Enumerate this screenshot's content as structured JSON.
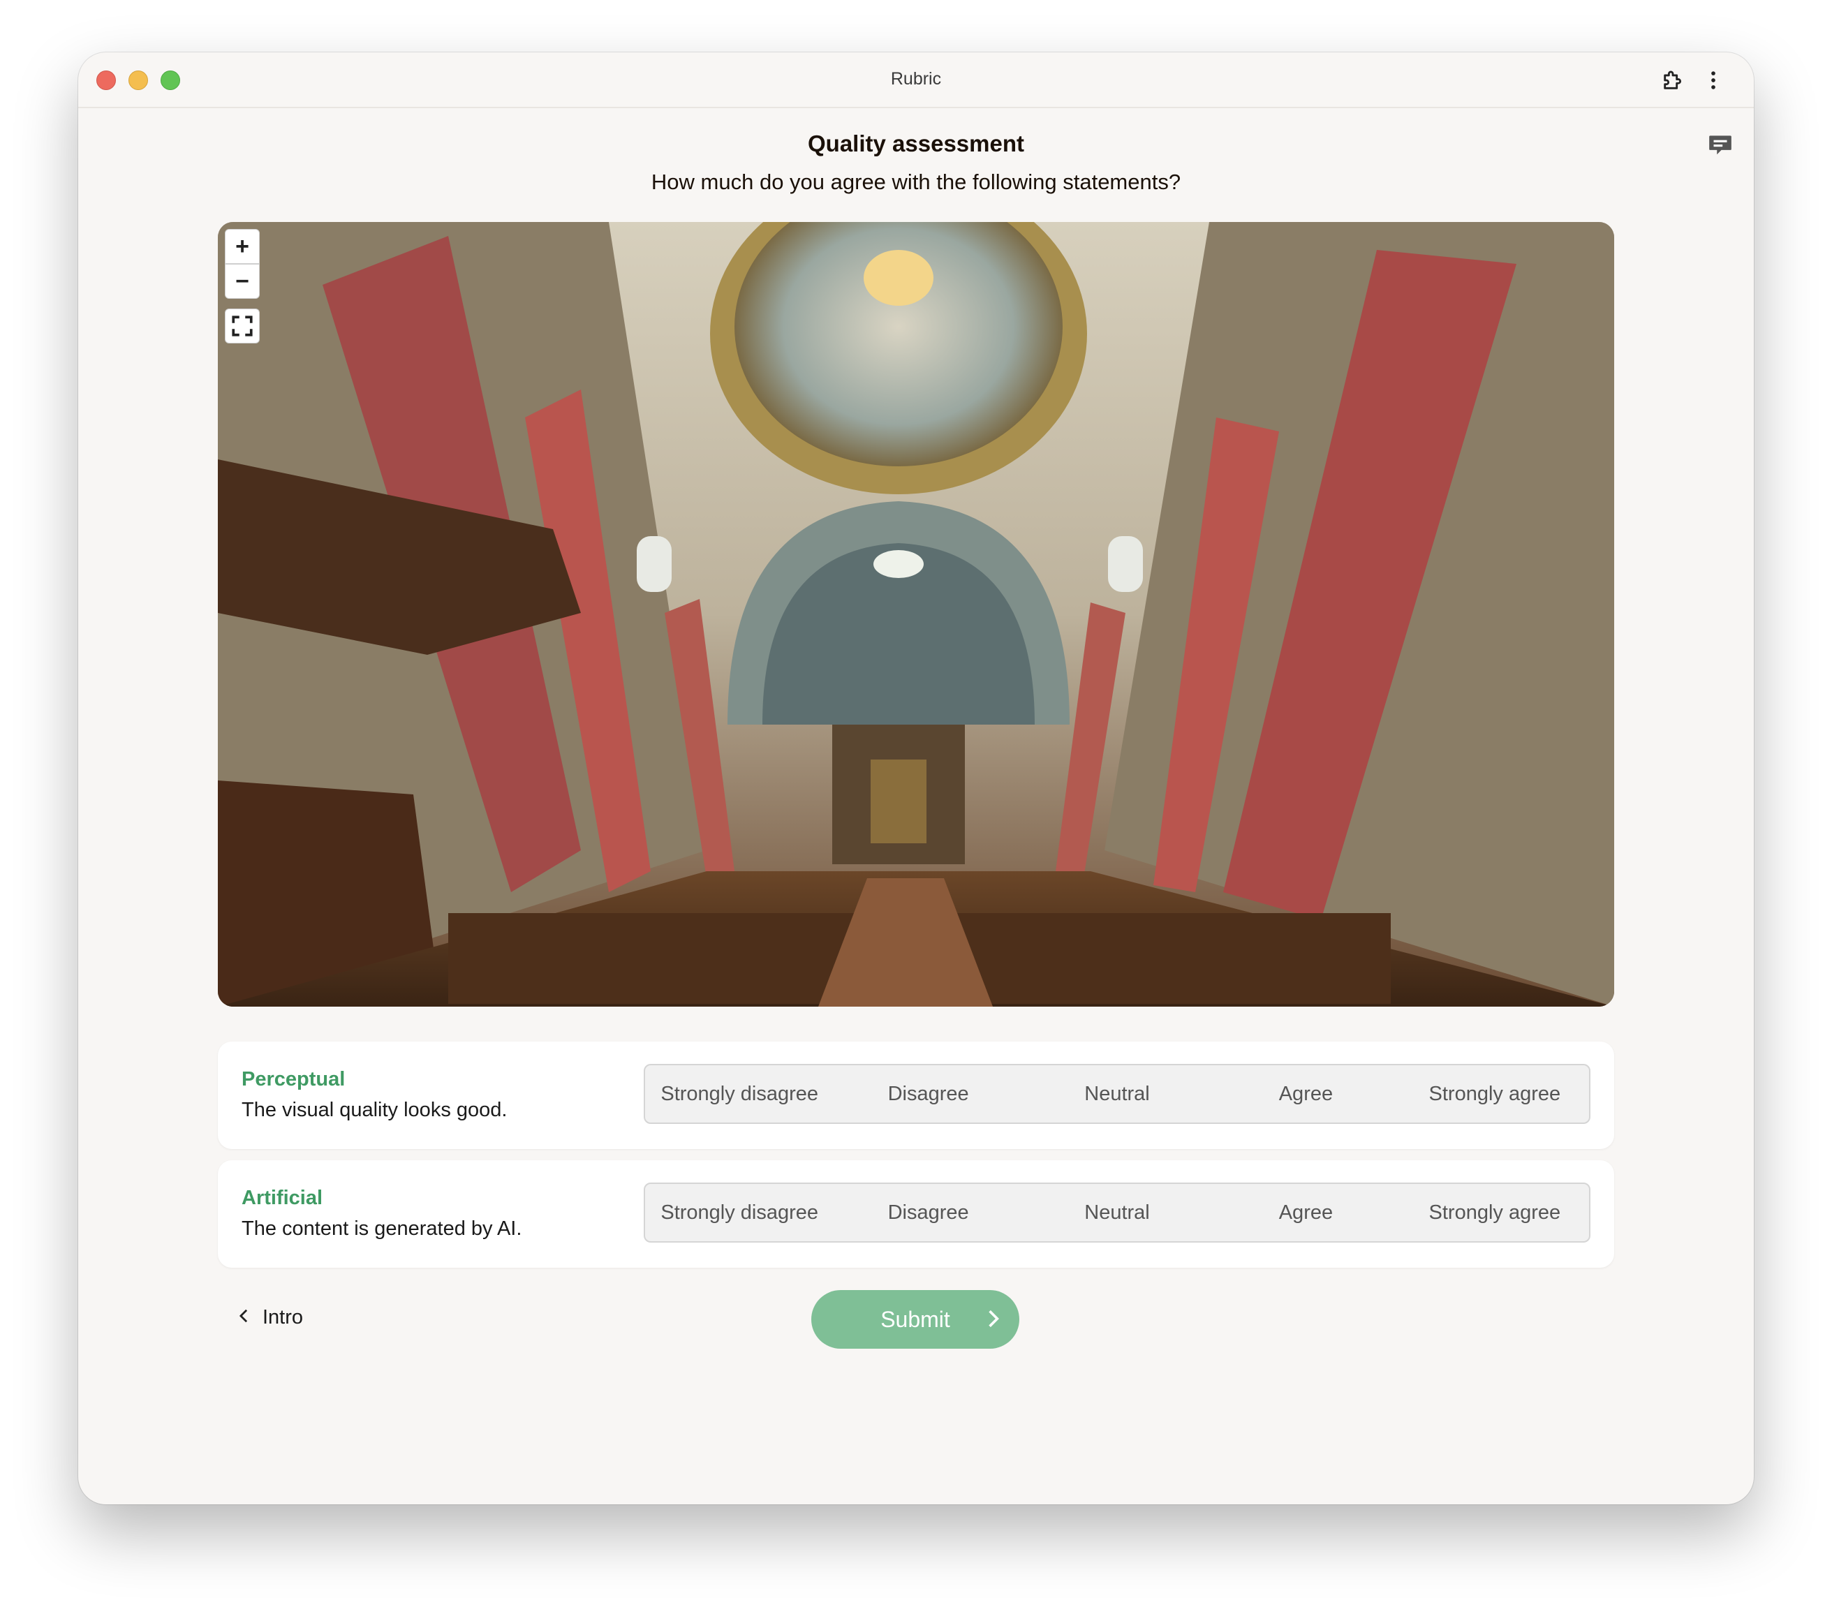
{
  "window": {
    "title": "Rubric",
    "extensions_icon": "puzzle-icon",
    "menu_icon": "more-vertical-icon"
  },
  "page": {
    "feedback_icon": "feedback-icon",
    "heading": "Quality assessment",
    "subheading": "How much do you agree with the following statements?"
  },
  "viewer": {
    "image_icon": "church-interior-photo",
    "zoom_in_label": "+",
    "zoom_out_label": "−",
    "fullscreen_icon": "fullscreen-icon"
  },
  "questions": [
    {
      "label": "Perceptual",
      "statement": "The visual quality looks good.",
      "options": [
        "Strongly disagree",
        "Disagree",
        "Neutral",
        "Agree",
        "Strongly agree"
      ]
    },
    {
      "label": "Artificial",
      "statement": "The content is generated by AI.",
      "options": [
        "Strongly disagree",
        "Disagree",
        "Neutral",
        "Agree",
        "Strongly agree"
      ]
    }
  ],
  "nav": {
    "back_label": "Intro",
    "submit_label": "Submit"
  },
  "colors": {
    "accent_green": "#3f9a63",
    "submit_green": "#7fbf96",
    "window_bg": "#f8f6f4"
  }
}
